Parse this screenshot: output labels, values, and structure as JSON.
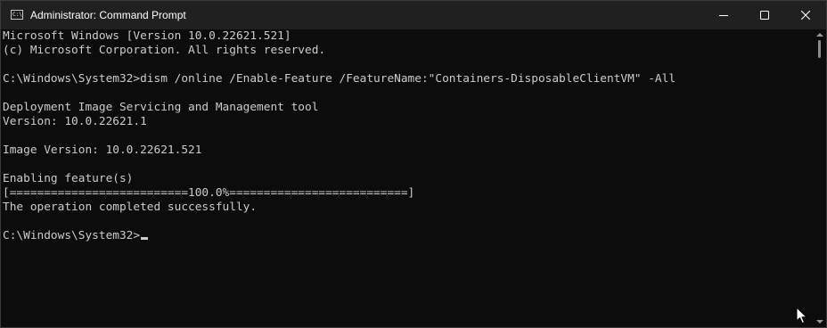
{
  "window": {
    "title": "Administrator: Command Prompt",
    "app_icon_text": "C:\\"
  },
  "console": {
    "lines": [
      "Microsoft Windows [Version 10.0.22621.521]",
      "(c) Microsoft Corporation. All rights reserved.",
      "",
      "C:\\Windows\\System32>dism /online /Enable-Feature /FeatureName:\"Containers-DisposableClientVM\" -All",
      "",
      "Deployment Image Servicing and Management tool",
      "Version: 10.0.22621.1",
      "",
      "Image Version: 10.0.22621.521",
      "",
      "Enabling feature(s)",
      "[==========================100.0%==========================]",
      "The operation completed successfully.",
      "",
      "C:\\Windows\\System32>"
    ]
  },
  "icons": {
    "app": "command-prompt-icon",
    "minimize": "minimize-icon",
    "maximize": "maximize-icon",
    "close": "close-icon",
    "pointer": "mouse-pointer-icon"
  },
  "colors": {
    "titlebar": "#202020",
    "console_background": "#0c0c0c",
    "console_text": "#cccccc"
  }
}
